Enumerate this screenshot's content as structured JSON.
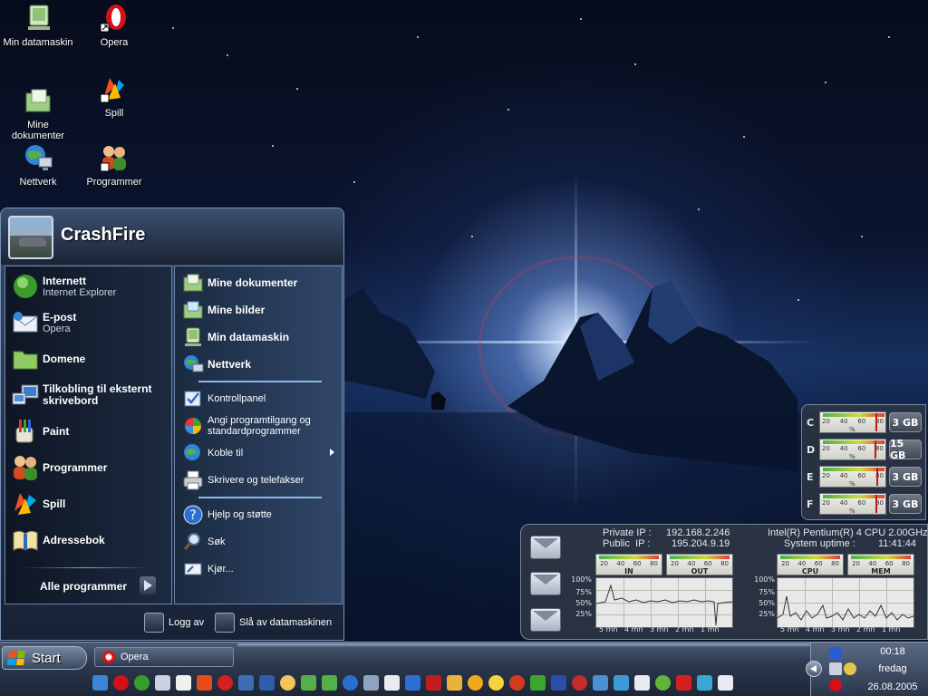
{
  "desktop": {
    "icons": [
      {
        "label": "Min datamaskin"
      },
      {
        "label": "Opera"
      },
      {
        "label": "Mine\ndokumenter"
      },
      {
        "label": "Spill"
      },
      {
        "label": "Nettverk"
      },
      {
        "label": "Programmer"
      }
    ]
  },
  "start_menu": {
    "user_name": "CrashFire",
    "left_items": [
      {
        "title": "Internett",
        "subtitle": "Internet Explorer",
        "icon": "internet-explorer-icon"
      },
      {
        "title": "E-post",
        "subtitle": "Opera",
        "icon": "email-icon"
      },
      {
        "title": "Domene",
        "subtitle": "",
        "icon": "folder-icon"
      },
      {
        "title": "Tilkobling til eksternt skrivebord",
        "subtitle": "",
        "icon": "remote-desktop-icon"
      },
      {
        "title": "Paint",
        "subtitle": "",
        "icon": "paint-icon"
      },
      {
        "title": "Programmer",
        "subtitle": "",
        "icon": "users-icon"
      },
      {
        "title": "Spill",
        "subtitle": "",
        "icon": "games-icon"
      },
      {
        "title": "Adressebok",
        "subtitle": "",
        "icon": "address-book-icon"
      }
    ],
    "all_programs": "Alle programmer",
    "right_items": [
      {
        "label": "Mine dokumenter",
        "icon": "documents-icon"
      },
      {
        "label": "Mine bilder",
        "icon": "pictures-icon"
      },
      {
        "label": "Min datamaskin",
        "icon": "computer-icon"
      },
      {
        "label": "Nettverk",
        "icon": "network-icon"
      },
      {
        "label": "Kontrollpanel",
        "icon": "control-panel-icon"
      },
      {
        "label": "Angi programtilgang og standardprogrammer",
        "icon": "default-programs-icon"
      },
      {
        "label": "Koble til",
        "icon": "connect-icon"
      },
      {
        "label": "Skrivere og telefakser",
        "icon": "printer-icon"
      },
      {
        "label": "Hjelp og støtte",
        "icon": "help-icon"
      },
      {
        "label": "Søk",
        "icon": "search-icon"
      },
      {
        "label": "Kjør...",
        "icon": "run-icon"
      }
    ],
    "logoff": "Logg av",
    "shutdown": "Slå av datamaskinen"
  },
  "drive_widget": {
    "scale": [
      "20",
      "40",
      "60",
      "80"
    ],
    "unit": "%",
    "drives": [
      {
        "letter": "C",
        "size": "3 GB",
        "usage": 0.88
      },
      {
        "letter": "D",
        "size": "15 GB",
        "usage": 0.86
      },
      {
        "letter": "E",
        "size": "3 GB",
        "usage": 0.9
      },
      {
        "letter": "F",
        "size": "3 GB",
        "usage": 0.88
      }
    ]
  },
  "system_widget": {
    "private_ip_label": "Private IP :",
    "private_ip": "192.168.2.246",
    "public_ip_label": "Public  IP :",
    "public_ip": "195.204.9.19",
    "cpu_name": "Intel(R) Pentium(R) 4 CPU 2.00GHz",
    "uptime_label": "System uptime :",
    "uptime": "11:41:44",
    "gauge_scale": [
      "20",
      "40",
      "60",
      "80"
    ],
    "gauges": {
      "in": "IN",
      "out": "OUT",
      "cpu": "CPU",
      "mem": "MEM"
    },
    "y_ticks": [
      "100%",
      "75%",
      "50%",
      "25%"
    ],
    "x_ticks": [
      "5 mn",
      "4 mn",
      "3 mn",
      "2 mn",
      "1 mn"
    ]
  },
  "taskbar": {
    "start_label": "Start",
    "open_window": "Opera",
    "clock_time": "00:18",
    "clock_day": "fredag",
    "clock_date": "26.08.2005"
  },
  "colors": {
    "accent": "#8fb6e6",
    "taskbar": "#2c384d",
    "start_menu_border": "#7891b5"
  }
}
